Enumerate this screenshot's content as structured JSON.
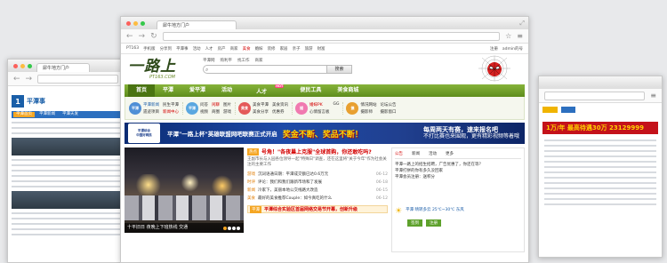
{
  "browser": {
    "tab_title": "犀牛地方门户",
    "nav_back": "←",
    "nav_forward": "→",
    "nav_reload": "↻",
    "star": "☆",
    "menu": "≡",
    "expand": "⤢"
  },
  "window_left": {
    "tab_title": "犀牛地方门户",
    "logo_num": "1",
    "logo_title": "平潭事",
    "nav": [
      "平潭首页",
      "平潭新闻",
      "平潭天发",
      "平潭"
    ],
    "ad_text": ""
  },
  "window_right": {
    "banner": "1万/年  最高待遇30万 23129999",
    "red_text": "",
    "btn1": "",
    "btn2": ""
  },
  "topnav": {
    "items": [
      "PT163",
      "手机版",
      "分享到",
      "平潭事",
      "平潭",
      "活动",
      "人才",
      "房产",
      "商家",
      "美食",
      "婚嫁",
      "装修",
      "家居",
      "亲子",
      "旅游",
      "财富"
    ],
    "right": [
      "注册",
      "admin的号"
    ]
  },
  "header": {
    "logo_main": "一路上",
    "logo_sub": "PT163.COM",
    "sub_links": [
      "平潭网",
      "购利平",
      "找工作",
      "商家"
    ],
    "search_placeholder": "搜索",
    "search_button": "搜索"
  },
  "mainnav": {
    "items": [
      "首页",
      "平潭",
      "爱平潭",
      "活动",
      "人才",
      "便民工具",
      "美食商城"
    ],
    "hot": "HOT"
  },
  "subnav": {
    "groups": [
      {
        "icon": "平潭",
        "color": "#4f8fd6",
        "links": [
          "平潭新闻",
          "民生平潭",
          "遗迹项目",
          "新闻中心"
        ]
      },
      {
        "icon": "平潭",
        "color": "#5aa7e0",
        "links": [
          "问答",
          "闲聊",
          "视频",
          "商圈",
          "图片",
          "游戏"
        ]
      },
      {
        "icon": "美食",
        "color": "#e45a5a",
        "links": [
          "美食平潭",
          "美食资讯",
          "美食分享",
          "优惠券"
        ]
      },
      {
        "icon": "婚",
        "color": "#f07ab0",
        "links": [
          "婚嫁PK",
          "GG",
          "心情留言板"
        ]
      },
      {
        "icon": "摄",
        "color": "#e8a030",
        "links": [
          "情况网站",
          "论坛公告",
          "摄影师",
          "摄影窗口"
        ]
      }
    ]
  },
  "ad": {
    "badge_top": "平潭综合",
    "badge_bottom": "中国好网民",
    "text": "平潭\"一路上杯\"英雄联盟网吧联赛正式开启",
    "yellow": "奖金不断、奖品不断！",
    "right_line1": "每周两天有赛，速来报名吧",
    "right_line2": "不打比赛也来围观，更有精彩视频等着哦"
  },
  "photo": {
    "caption": "十平旧日 夜晚上下班热线 交通"
  },
  "news": {
    "tag": "热点",
    "headline": "号角！\"各夜巢上克服\"全球首购，你还敢吃吗?",
    "summary": "王副市长与入园各位领导一起\"特殊日\"调查，还在这里将\"关于今年\"作为社会关注的主要工作",
    "items": [
      {
        "cat": "游戏",
        "title": "沉词语通日期：平潭成交额已达0.6万元",
        "time": "06-12"
      },
      {
        "cat": "时评",
        "title": "评论：我们和我们跟新市场和了发展",
        "time": "06-18"
      },
      {
        "cat": "新闻",
        "title": "冷家下，美丽本地公交线路大改造",
        "time": "06-15"
      },
      {
        "cat": "美食",
        "title": "最好的美食推荐Couple：如今真吃的什么",
        "time": "06-12"
      }
    ],
    "bottom_tag": "平潭",
    "bottom_text": "平潭综合实验区首届网络交易节开幕，创新升级"
  },
  "side": {
    "tabs": [
      "公告",
      "新闻",
      "活动",
      "更多"
    ],
    "notice": [
      "平潭一路上的招生招聘，广告优惠了，你还在等？",
      "平潭打拼的你有多久没回家",
      "平潭会员注册：送积分"
    ],
    "weather": "平潭 晴转多云 25℃~30℃ 东风",
    "btn1": "签到",
    "btn2": "注册"
  },
  "colors": {
    "nav_green": "#6b9b24",
    "accent_red": "#d40000",
    "ad_blue": "#1e4aa8"
  }
}
